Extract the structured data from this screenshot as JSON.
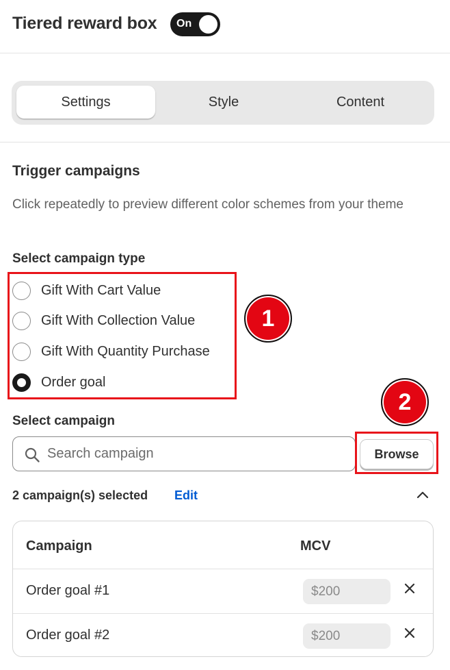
{
  "header": {
    "title": "Tiered reward box",
    "toggle_label": "On"
  },
  "tabs": [
    {
      "label": "Settings",
      "active": true
    },
    {
      "label": "Style",
      "active": false
    },
    {
      "label": "Content",
      "active": false
    }
  ],
  "trigger": {
    "title": "Trigger campaigns",
    "description": "Click repeatedly to preview different color schemes from your theme",
    "type_label": "Select campaign type",
    "options": [
      {
        "label": "Gift With Cart Value",
        "checked": false
      },
      {
        "label": "Gift With Collection Value",
        "checked": false
      },
      {
        "label": "Gift With Quantity Purchase",
        "checked": false
      },
      {
        "label": "Order goal",
        "checked": true
      }
    ]
  },
  "campaign": {
    "label": "Select campaign",
    "search_placeholder": "Search campaign",
    "browse_label": "Browse",
    "selected_text": "2 campaign(s) selected",
    "edit_label": "Edit"
  },
  "table": {
    "headers": [
      "Campaign",
      "MCV"
    ],
    "rows": [
      {
        "name": "Order goal #1",
        "mcv": "$200"
      },
      {
        "name": "Order goal #2",
        "mcv": "$200"
      }
    ]
  },
  "annotations": {
    "badge1": "1",
    "badge2": "2"
  },
  "colors": {
    "accent_link": "#005bd3",
    "annotation_red": "#e30613",
    "toggle_bg": "#1a1a1a"
  },
  "icons": {
    "search": "search-icon",
    "chevron": "chevron-up-icon",
    "remove": "close-icon"
  }
}
